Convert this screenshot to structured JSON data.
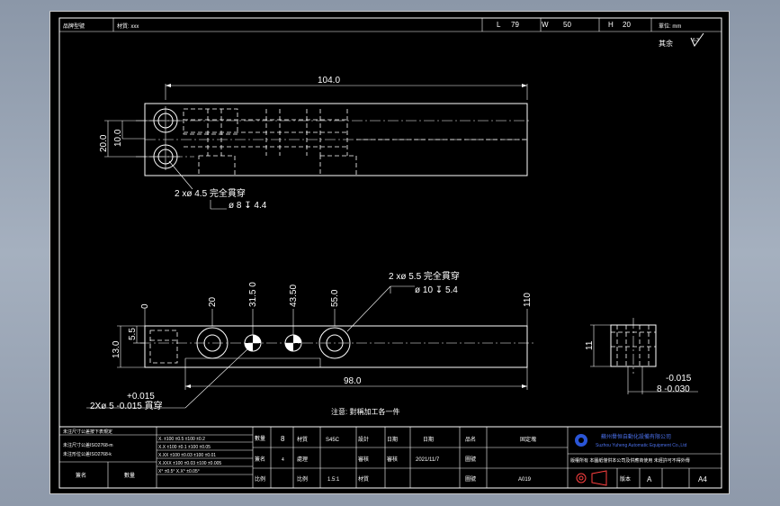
{
  "top_strip": {
    "label_a": "品牌型號",
    "label_b": "材質: xxx",
    "dim_L_symbol": "L",
    "dim_L": "79",
    "dim_W_symbol": "W",
    "dim_W": "50",
    "dim_H_symbol": "H",
    "dim_H": "20",
    "unit_label": "單位: mm"
  },
  "roughness_note": "其余",
  "roughness_symbol": "6.3",
  "top_view": {
    "length": "104.0",
    "height": "20.0",
    "half_height": "10.0",
    "hole_note_line1": "2 xø  4.5 完全貫穿",
    "hole_note_line2": "ø 8 ↧ 4.4"
  },
  "front_view": {
    "dim_0": "0",
    "dim_20": "20",
    "dim_31_5": "31.5 0",
    "dim_43_5": "43.50",
    "dim_55": "55.0",
    "dim_110": "110",
    "dim_13": "13.0",
    "dim_5_5": "5.5",
    "dim_98": "98.0",
    "hole_note_line1": "2 xø  5.5 完全貫穿",
    "hole_note_line2": "ø 10 ↧ 5.4",
    "pin_tol_upper": "+0.015",
    "pin_note": "2Xø 5 -0.015 貫穿"
  },
  "side_view": {
    "dim_11": "11",
    "tol_upper": "-0.015",
    "tol_main": "8 -0.030"
  },
  "note": "注意: 對稱加工各一件",
  "title_block": {
    "tol_title": "未注尺寸公差按下表規定",
    "tol_line1": "未注尺寸公差ISO2768-m",
    "tol_line2": "未注形位公差ISO2768-k",
    "tol_rows": [
      "X.    ±100 ±0.5 ±100 ±0.2",
      "X.X   ±100 ±0.1 ±100 ±0.05",
      "X.XX  ±100 ±0.03 ±100 ±0.01",
      "X.XXX ±100 ±0.03 ±100 ±0.005",
      "X° ±0.5°   X.X° ±0.05°"
    ],
    "sign_label": "簽名",
    "qty_label": "數量",
    "qty": "8",
    "material_label": "材質",
    "material": "S45C",
    "design_label": "設計",
    "date_label": "日期",
    "date": "2021/11/7",
    "part_label": "品名",
    "part": "固定塊",
    "scale_label": "比例",
    "scale": "1.5:1",
    "treat_label": "處理",
    "check_label": "審核",
    "review_label": "審核",
    "drawing_label": "圖號",
    "drawing_no": "A019",
    "company_cn": "蘇州譽恒自動化設備有限公司",
    "company_en": "Suzhou Yuheng Automatic Equipment Co.,Ltd",
    "confidential": "版權所有 本圖紙僅供本公司及供應商使用 未經許可不得外傳",
    "sheet_label": "版本",
    "sheet_rev": "A",
    "paper_size": "A4",
    "unit_small": "4"
  },
  "colors": {
    "background": "#000000",
    "lines": "#ffffff",
    "frame_outer": "#8e99aa"
  }
}
